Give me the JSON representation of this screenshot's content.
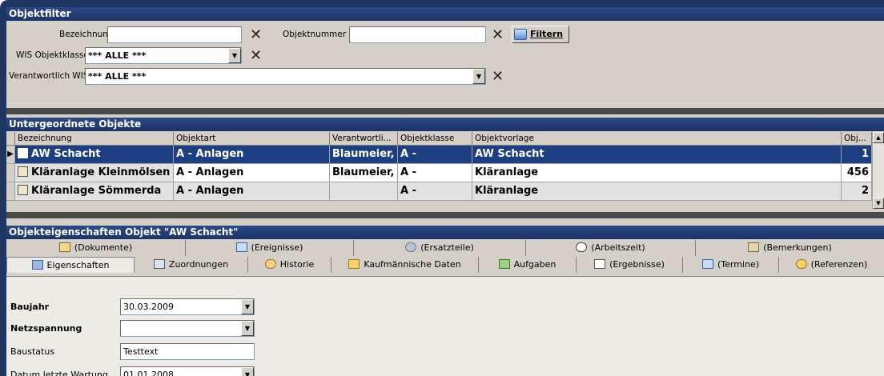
{
  "objektfilter": {
    "title": "Objektfilter",
    "bezeichnung_label": "Bezeichnung",
    "bezeichnung_value": "",
    "objektnummer_label": "Objektnummer",
    "objektnummer_value": "",
    "filter_button": "Filtern",
    "wis_objektklasse_label": "WIS Objektklasse",
    "wis_objektklasse_value": "*** ALLE ***",
    "verantwortlich_label": "Verantwortlich WIS",
    "verantwortlich_value": "*** ALLE ***"
  },
  "untergeordnete": {
    "title": "Untergeordnete Objekte",
    "columns": [
      "Bezeichnung",
      "Objektart",
      "Verantwortli...",
      "Objektklasse",
      "Objektvorlage",
      "Obj..."
    ],
    "rows": [
      [
        "AW Schacht",
        "A - Anlagen",
        "Blaumeier,",
        "A -",
        "AW Schacht",
        "1"
      ],
      [
        "Kläranlage Kleinmölsen",
        "A - Anlagen",
        "Blaumeier,",
        "A -",
        "Kläranlage",
        "456"
      ],
      [
        "Kläranlage Sömmerda",
        "A - Anlagen",
        "",
        "A -",
        "Kläranlage",
        "2"
      ]
    ]
  },
  "eigenschaften": {
    "title": "Objekteigenschaften Objekt \"AW Schacht\"",
    "tabs_top": [
      "(Dokumente)",
      "(Ereignisse)",
      "(Ersatzteile)",
      "(Arbeitszeit)",
      "(Bemerkungen)"
    ],
    "tabs_bottom": [
      "Eigenschaften",
      "Zuordnungen",
      "Historie",
      "Kaufmännische Daten",
      "Aufgaben",
      "(Ergebnisse)",
      "(Termine)",
      "(Referenzen)"
    ],
    "fields": [
      {
        "label": "Baujahr",
        "value": "30.03.2009"
      },
      {
        "label": "Netzspannung",
        "value": ""
      },
      {
        "label": "Baustatus",
        "value": "Testtext"
      },
      {
        "label": "Datum letzte Wartung",
        "value": "01.01.2008"
      }
    ]
  }
}
